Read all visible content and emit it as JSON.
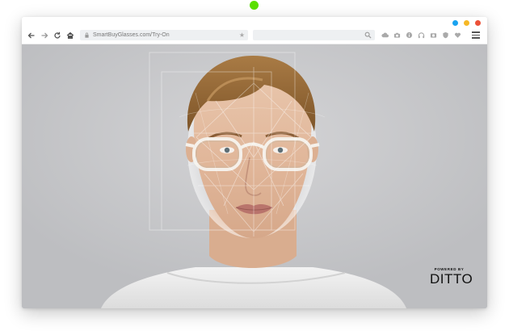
{
  "browser": {
    "url": "SmartBuyGlasses.com/Try-On",
    "search_placeholder": ""
  },
  "overlay": {
    "powered_by_label": "POWERED BY",
    "brand_logo_text": "DITTO"
  },
  "colors": {
    "accent_dot": "#5be000",
    "traffic_blue": "#1aa3f0",
    "traffic_yellow": "#f6b826",
    "traffic_red": "#ec5138"
  },
  "icons": [
    "back-arrow-icon",
    "forward-arrow-icon",
    "reload-icon",
    "home-icon",
    "lock-icon",
    "bookmark-star-icon",
    "search-icon",
    "cloud-icon",
    "camera-icon",
    "info-icon",
    "headphones-icon",
    "screenshot-icon",
    "shield-icon",
    "heart-icon",
    "menu-icon"
  ]
}
